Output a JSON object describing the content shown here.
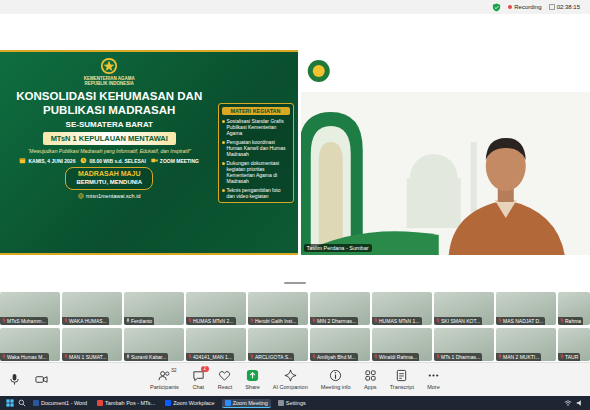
{
  "top_bar": {
    "recording_label": "Recording",
    "timer": "02:38:15"
  },
  "shared_screen": {
    "logo_caption": [
      "KEMENTERIAN AGAMA",
      "REPUBLIK INDONESIA"
    ],
    "title_lines": [
      "KONSOLIDASI KEHUMASAN DAN",
      "PUBLIKASI MADRASAH"
    ],
    "subtitle": "SE-SUMATERA BARAT",
    "host": "MTsN 1 KEPULAUAN MENTAWAI",
    "tagline": "“Mewujudkan Publikasi Madrasah yang Informatif, Edukatif, dan Inspiratif”",
    "details": [
      {
        "kind": "date",
        "text": "KAMIS, 4 JUNI 2026"
      },
      {
        "kind": "time",
        "text": "08.00 WIB s.d. SELESAI"
      },
      {
        "kind": "platform",
        "text": "ZOOM MEETING"
      }
    ],
    "materials_title": "MATERI KEGIATAN",
    "materials": [
      "Sosialisasi Standar Grafis Publikasi Kementerian Agama",
      "Penguatan koordinasi Humas Kanwil dan Humas Madrasah",
      "Dukungan dokumentasi kegiatan prioritas Kementerian Agama di Madrasah",
      "Teknis pengambilan foto dan video kegiatan"
    ],
    "motto": [
      "MADRASAH MAJU",
      "BERMUTU, MENDUNIA"
    ],
    "website": "mtsn1mentawai.sch.id"
  },
  "speaker_video": {
    "name": "Taslim Perdana - Sumbar"
  },
  "participants": [
    {
      "name": "MTsS Muhamm...",
      "muted": true
    },
    {
      "name": "WAKA HUMAS...",
      "muted": true
    },
    {
      "name": "Ferdianto",
      "muted": false
    },
    {
      "name": "HUMAS MTsN 2...",
      "muted": true
    },
    {
      "name": "Hendri Galih Inst...",
      "muted": true
    },
    {
      "name": "MIN 2 Dharmas...",
      "muted": true
    },
    {
      "name": "HUMAS MTsN 1...",
      "muted": true
    },
    {
      "name": "SKI SMAN KOT...",
      "muted": true
    },
    {
      "name": "MAS NADJAT D...",
      "muted": true
    },
    {
      "name": "Rahma",
      "muted": true
    },
    {
      "name": "Waka Humas M...",
      "muted": true
    },
    {
      "name": "MAN 1 SUMAT...",
      "muted": true
    },
    {
      "name": "Suzanti Kabar...",
      "muted": false
    },
    {
      "name": "424141_MAN 1...",
      "muted": true
    },
    {
      "name": "ARCLIGOTA S...",
      "muted": true
    },
    {
      "name": "Amiliyah Bhd M...",
      "muted": true
    },
    {
      "name": "Winaldi Rahma...",
      "muted": true
    },
    {
      "name": "MTs 1 Dharmas...",
      "muted": true
    },
    {
      "name": "MAN 2 MUKTI...",
      "muted": true
    },
    {
      "name": "TAUR",
      "muted": true
    }
  ],
  "toolbar": {
    "items": [
      {
        "kind": "participants",
        "label": "Participants",
        "badge": "32"
      },
      {
        "kind": "chat",
        "label": "Chat",
        "badge": "2"
      },
      {
        "kind": "react",
        "label": "React",
        "badge": ""
      },
      {
        "kind": "share",
        "label": "Share",
        "badge": ""
      },
      {
        "kind": "ai",
        "label": "AI Companion",
        "badge": ""
      },
      {
        "kind": "info",
        "label": "Meeting info",
        "badge": ""
      },
      {
        "kind": "apps",
        "label": "Apps",
        "badge": ""
      },
      {
        "kind": "transcript",
        "label": "Transcript",
        "badge": ""
      },
      {
        "kind": "more",
        "label": "More",
        "badge": ""
      }
    ]
  },
  "taskbar": {
    "apps": [
      {
        "label": "Document1 - Word",
        "selected": false,
        "color": "#2b579a"
      },
      {
        "label": "Tambah Pos - MTs...",
        "selected": false,
        "color": "#e8453c"
      },
      {
        "label": "Zoom Workplace",
        "selected": false,
        "color": "#0b5cff"
      },
      {
        "label": "Zoom Meeting",
        "selected": true,
        "color": "#2d8cff"
      },
      {
        "label": "Settings",
        "selected": false,
        "color": "#8a8f98"
      }
    ]
  }
}
